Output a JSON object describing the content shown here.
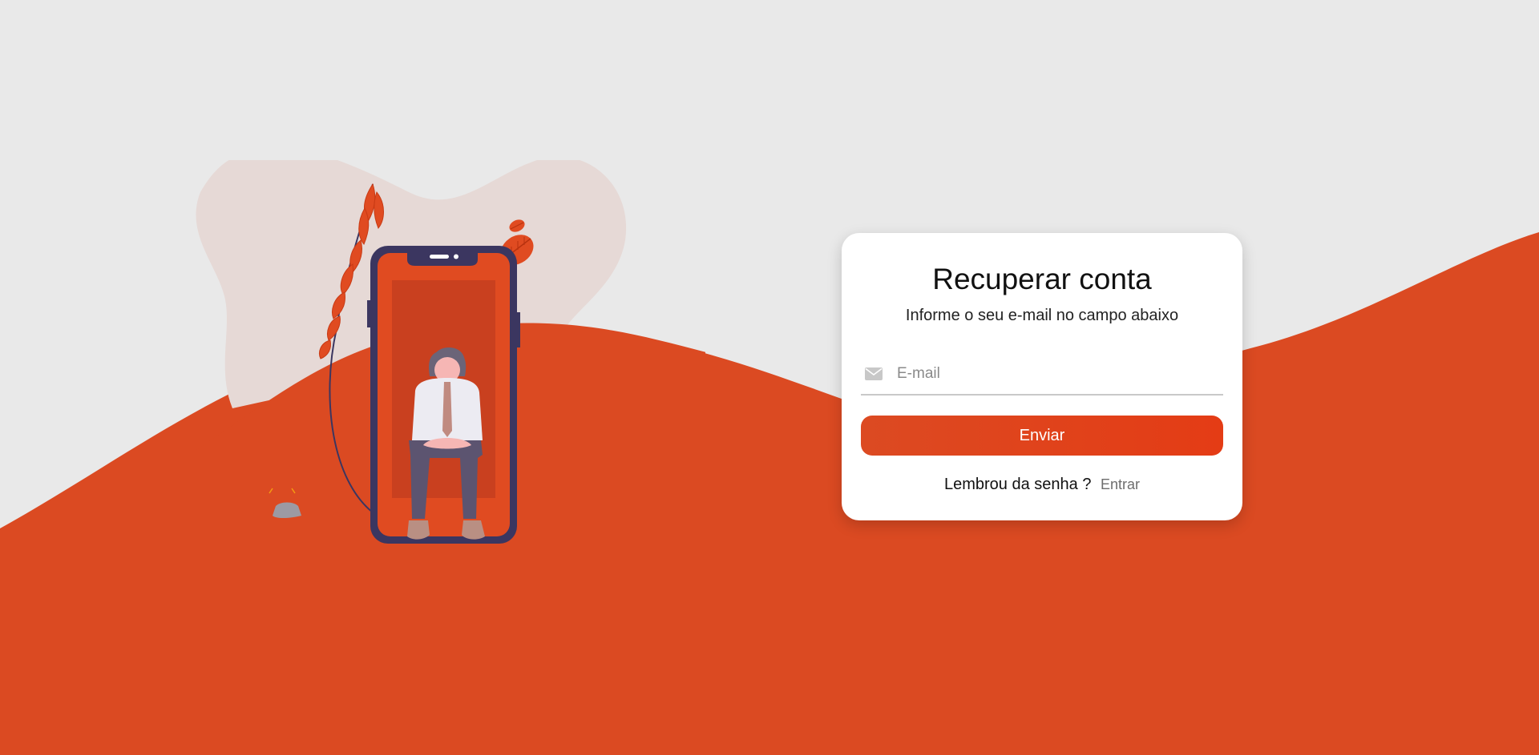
{
  "colors": {
    "background": "#e9e9e9",
    "accent": "#db4a22",
    "button": "#e0421b",
    "card": "#ffffff"
  },
  "card": {
    "title": "Recuperar conta",
    "subtitle": "Informe o seu e-mail no campo abaixo",
    "email_field": {
      "placeholder": "E-mail",
      "value": "",
      "icon": "envelope-icon"
    },
    "submit_label": "Enviar",
    "footer_prompt": "Lembrou da senha ?",
    "footer_link": "Entrar"
  }
}
